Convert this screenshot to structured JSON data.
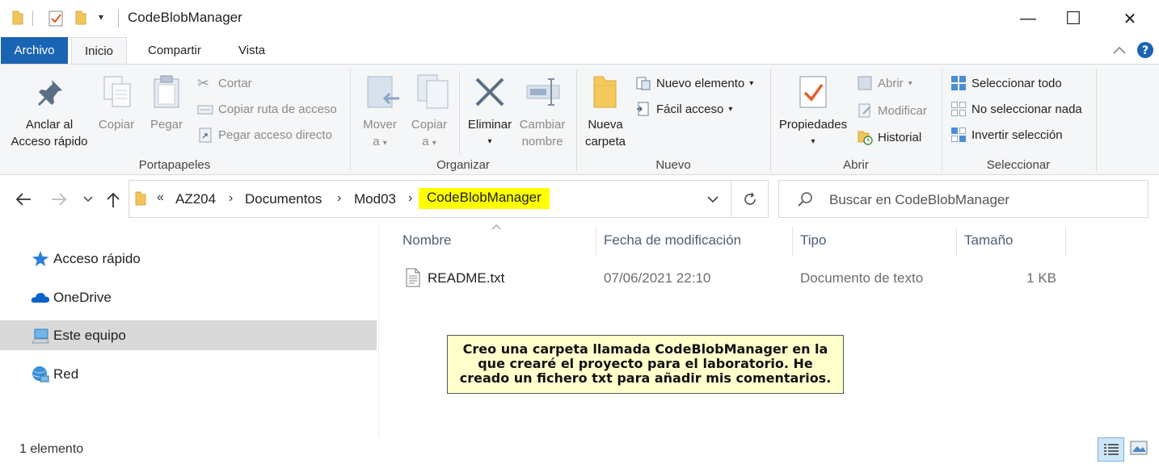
{
  "window": {
    "title": "CodeBlobManager",
    "minimize_glyph": "—",
    "maximize_glyph": "☐",
    "close_glyph": "✕"
  },
  "ribbon_tabs": [
    {
      "label": "Archivo"
    },
    {
      "label": "Inicio"
    },
    {
      "label": "Compartir"
    },
    {
      "label": "Vista"
    }
  ],
  "ribbon": {
    "portapapeles": {
      "group_label": "Portapapeles",
      "pin_line1": "Anclar al",
      "pin_line2": "Acceso rápido",
      "copy": "Copiar",
      "paste": "Pegar",
      "cut": "Cortar",
      "copy_path": "Copiar ruta de acceso",
      "paste_shortcut": "Pegar acceso directo"
    },
    "organizar": {
      "group_label": "Organizar",
      "move_line1": "Mover",
      "move_line2": "a",
      "copy_line1": "Copiar",
      "copy_line2": "a",
      "delete": "Eliminar",
      "rename_line1": "Cambiar",
      "rename_line2": "nombre"
    },
    "nuevo": {
      "group_label": "Nuevo",
      "new_folder_line1": "Nueva",
      "new_folder_line2": "carpeta",
      "new_item": "Nuevo elemento",
      "easy_access": "Fácil acceso"
    },
    "abrir": {
      "group_label": "Abrir",
      "properties": "Propiedades",
      "open": "Abrir",
      "edit": "Modificar",
      "history": "Historial"
    },
    "seleccionar": {
      "group_label": "Seleccionar",
      "select_all": "Seleccionar todo",
      "select_none": "No seleccionar nada",
      "invert": "Invertir selección"
    }
  },
  "address": {
    "overflow": "«",
    "crumbs": [
      "AZ204",
      "Documentos",
      "Mod03",
      "CodeBlobManager"
    ],
    "highlight_color": "#ffff00"
  },
  "search": {
    "placeholder": "Buscar en CodeBlobManager"
  },
  "nav_pane": [
    {
      "label": "Acceso rápido",
      "icon": "star-icon"
    },
    {
      "label": "OneDrive",
      "icon": "cloud-icon"
    },
    {
      "label": "Este equipo",
      "icon": "computer-icon",
      "selected": true
    },
    {
      "label": "Red",
      "icon": "network-icon"
    }
  ],
  "columns": [
    "Nombre",
    "Fecha de modificación",
    "Tipo",
    "Tamaño"
  ],
  "files": [
    {
      "name": "README.txt",
      "modified": "07/06/2021 22:10",
      "type": "Documento de texto",
      "size": "1 KB"
    }
  ],
  "note": {
    "line1": "Creo una carpeta llamada CodeBlobManager en la",
    "line2": "que crearé el proyecto para el laboratorio. He",
    "line3": "creado un fichero txt para añadir mis comentarios."
  },
  "status": {
    "count": "1 elemento"
  },
  "colors": {
    "file_tab": "#1a64b4",
    "ribbon_bg": "#f5f6f7",
    "selection": "#d9d9d9",
    "note_bg": "#ffffcc"
  }
}
